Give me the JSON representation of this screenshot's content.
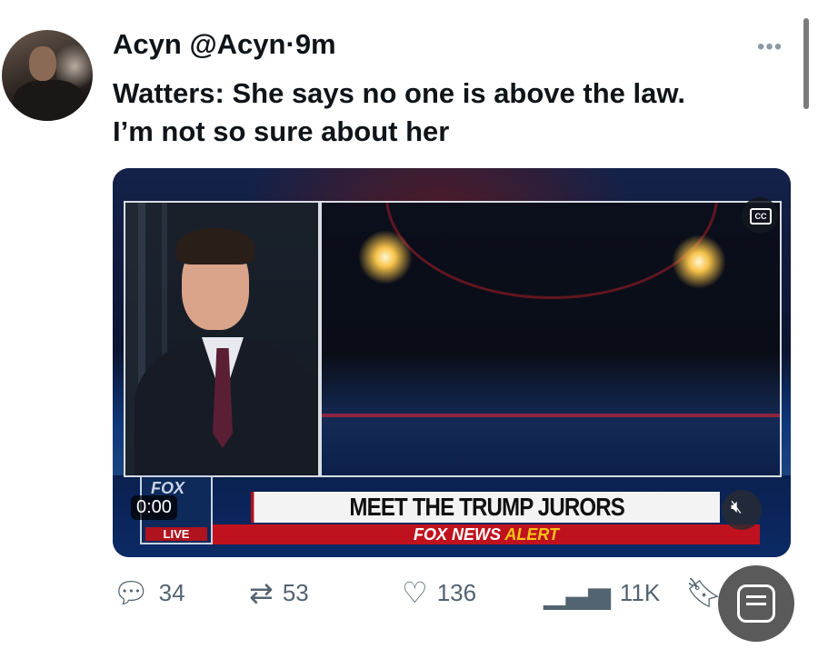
{
  "tweet": {
    "display_name": "Acyn",
    "handle": "@Acyn",
    "separator": "·",
    "time": "9m",
    "more_icon": "more-icon",
    "text_line1": "Watters: She says no one is above the law.",
    "text_line2": "I’m not so sure about her"
  },
  "video": {
    "time": "0:00",
    "cc_label": "CC",
    "network": "FOX",
    "live_label": "LIVE",
    "headline": "MEET THE TRUMP JURORS",
    "alert_part1": "FOX NEWS",
    "alert_part2": "ALERT",
    "mute_icon": "volume-muted-icon"
  },
  "actions": {
    "replies": "34",
    "retweets": "53",
    "likes": "136",
    "views": "11K"
  }
}
